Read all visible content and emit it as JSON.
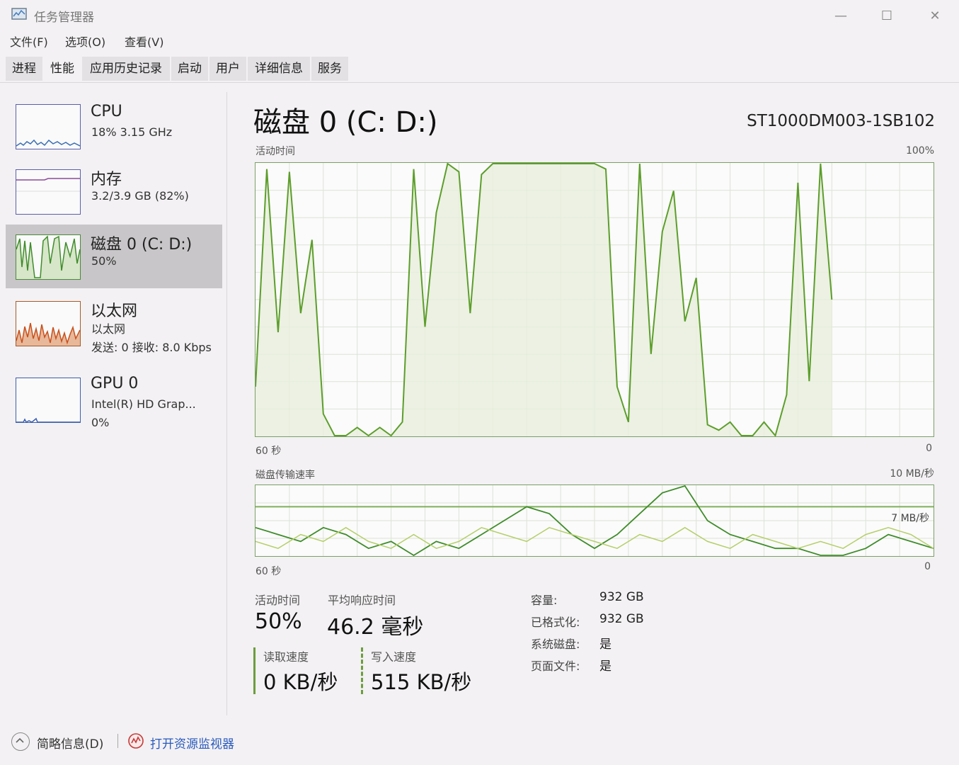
{
  "window": {
    "title": "任务管理器",
    "minimize": "—",
    "maximize": "☐",
    "close": "✕"
  },
  "menu": [
    "文件(F)",
    "选项(O)",
    "查看(V)"
  ],
  "tabs": [
    "进程",
    "性能",
    "应用历史记录",
    "启动",
    "用户",
    "详细信息",
    "服务"
  ],
  "active_tab": 1,
  "sidebar": {
    "cpu": {
      "name": "CPU",
      "sub": "18%  3.15 GHz"
    },
    "memory": {
      "name": "内存",
      "sub": "3.2/3.9 GB (82%)"
    },
    "disk": {
      "name": "磁盘 0 (C: D:)",
      "sub": "50%"
    },
    "ethernet": {
      "name": "以太网",
      "sub1": "以太网",
      "sub2": "发送: 0  接收: 8.0 Kbps"
    },
    "gpu": {
      "name": "GPU 0",
      "sub1": "Intel(R) HD Grap...",
      "sub2": "0%"
    }
  },
  "main": {
    "title": "磁盘 0 (C: D:)",
    "model": "ST1000DM003-1SB102",
    "activity_label": "活动时间",
    "activity_max": "100%",
    "activity_time_left": "60 秒",
    "activity_time_right": "0",
    "transfer_label": "磁盘传输速率",
    "transfer_max": "10 MB/秒",
    "transfer_line_label": "7 MB/秒",
    "transfer_time_left": "60 秒",
    "transfer_time_right": "0"
  },
  "stats": {
    "active_time_label": "活动时间",
    "active_time_value": "50%",
    "avg_response_label": "平均响应时间",
    "avg_response_value": "46.2 毫秒",
    "read_label": "读取速度",
    "read_value": "0 KB/秒",
    "write_label": "写入速度",
    "write_value": "515 KB/秒"
  },
  "properties": [
    {
      "key": "容量:",
      "value": "932 GB"
    },
    {
      "key": "已格式化:",
      "value": "932 GB"
    },
    {
      "key": "系统磁盘:",
      "value": "是"
    },
    {
      "key": "页面文件:",
      "value": "是"
    }
  ],
  "footer": {
    "fewer_details": "简略信息(D)",
    "resource_monitor": "打开资源监视器"
  },
  "colors": {
    "disk_line": "#5c9e2a",
    "disk_fill": "#e8efdd",
    "accent_link": "#2a5bbd",
    "thumb_border": "#5a5fae"
  },
  "chart_data": [
    {
      "type": "area",
      "title": "活动时间",
      "ylim": [
        0,
        100
      ],
      "x": [
        60,
        59,
        58,
        57,
        56,
        55,
        54,
        53,
        52,
        51,
        50,
        49,
        48,
        47,
        46,
        45,
        44,
        43,
        42,
        41,
        40,
        39,
        38,
        37,
        36,
        35,
        34,
        33,
        32,
        31,
        30,
        29,
        28,
        27,
        26,
        25,
        24,
        23,
        22,
        21,
        20,
        19,
        18,
        17,
        16,
        15,
        14,
        13,
        12,
        11,
        10,
        9,
        8,
        7,
        6,
        5,
        4,
        3,
        2,
        1,
        0
      ],
      "series": [
        {
          "values": [
            18,
            98,
            38,
            97,
            45,
            72,
            8,
            0,
            0,
            3,
            0,
            3,
            0,
            5,
            98,
            40,
            82,
            100,
            97,
            45,
            96,
            100,
            100,
            100,
            100,
            100,
            100,
            100,
            100,
            100,
            100,
            98,
            18,
            5,
            100,
            30,
            75,
            90,
            42,
            58,
            4,
            2,
            5,
            0,
            0,
            5,
            0,
            15,
            93,
            20,
            100,
            50
          ]
        }
      ]
    },
    {
      "type": "line",
      "title": "磁盘传输速率",
      "ylim": [
        0,
        10
      ],
      "x": [
        60,
        58,
        56,
        54,
        52,
        50,
        48,
        46,
        44,
        42,
        40,
        38,
        36,
        34,
        32,
        30,
        28,
        26,
        24,
        22,
        20,
        18,
        16,
        14,
        12,
        10,
        8,
        6,
        4,
        2,
        0
      ],
      "series": [
        {
          "values": [
            4,
            3,
            2,
            4,
            3,
            1,
            2,
            0,
            2,
            1,
            3,
            5,
            7,
            6,
            3,
            1,
            3,
            6,
            9,
            10,
            5,
            3,
            2,
            1,
            1,
            0,
            0,
            1,
            3,
            2,
            1
          ]
        },
        {
          "values": [
            2,
            1,
            3,
            2,
            4,
            2,
            1,
            3,
            1,
            2,
            4,
            3,
            2,
            4,
            3,
            2,
            1,
            3,
            2,
            4,
            2,
            1,
            3,
            2,
            1,
            2,
            1,
            3,
            4,
            3,
            1
          ]
        }
      ]
    }
  ]
}
